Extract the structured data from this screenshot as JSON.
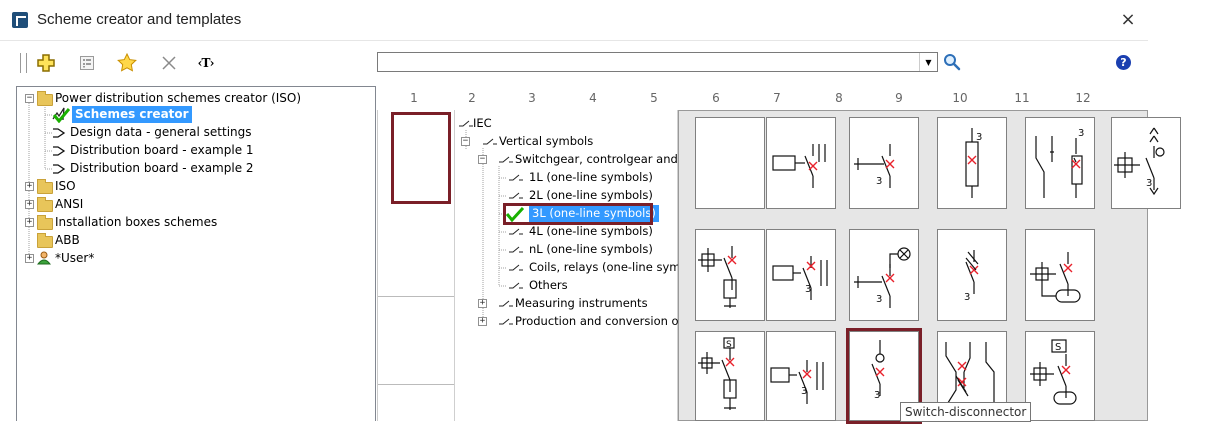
{
  "window": {
    "title": "Scheme creator and templates",
    "close_symbol": "×"
  },
  "toolbar": {
    "buttons": [
      {
        "name": "add-button",
        "icon": "plus-icon"
      },
      {
        "name": "properties-button",
        "icon": "properties-icon"
      },
      {
        "name": "favorite-button",
        "icon": "star-icon"
      },
      {
        "name": "delete-button",
        "icon": "close-x-icon"
      },
      {
        "name": "text-tag-button",
        "icon": "text-tag-icon",
        "label": "‹T›"
      }
    ],
    "search": {
      "value": "",
      "placeholder": ""
    },
    "dropdown_symbol": "▼",
    "help_symbol": "?"
  },
  "tree": {
    "items": [
      {
        "label": "Power distribution schemes creator (ISO)",
        "expander": "−",
        "icon": "folder-icon"
      },
      {
        "label": "Schemes creator",
        "icon": "check-icon",
        "selected": true
      },
      {
        "label": "Design data - general settings",
        "icon": "arrow-icon"
      },
      {
        "label": "Distribution board - example 1",
        "icon": "arrow-icon"
      },
      {
        "label": "Distribution board - example 2",
        "icon": "arrow-icon"
      },
      {
        "label": "ISO",
        "expander": "+",
        "icon": "folder-icon"
      },
      {
        "label": "ANSI",
        "expander": "+",
        "icon": "folder-icon"
      },
      {
        "label": "Installation boxes schemes",
        "expander": "+",
        "icon": "folder-icon"
      },
      {
        "label": "ABB",
        "icon": "folder-icon"
      },
      {
        "label": "*User*",
        "expander": "+",
        "icon": "user-icon"
      }
    ]
  },
  "column_numbers": [
    "1",
    "2",
    "3",
    "4",
    "5",
    "6",
    "7",
    "8",
    "9",
    "10",
    "11",
    "12"
  ],
  "symbol_tree": {
    "items": [
      {
        "label": "IEC"
      },
      {
        "label": "Vertical symbols",
        "expander": "−"
      },
      {
        "label": "Switchgear, controlgear and p",
        "expander": "−"
      },
      {
        "label": "1L (one-line symbols)"
      },
      {
        "label": "2L (one-line symbols)"
      },
      {
        "label": "3L (one-line symbols)",
        "selected": true
      },
      {
        "label": "4L (one-line symbols)"
      },
      {
        "label": "nL (one-line symbols)"
      },
      {
        "label": "Coils, relays (one-line sym"
      },
      {
        "label": "Others"
      },
      {
        "label": "Measuring instruments",
        "expander": "+"
      },
      {
        "label": "Production and conversion of",
        "expander": "+"
      }
    ]
  },
  "symbols": {
    "row1": [
      "empty",
      "contactor-relay",
      "circuit-breaker",
      "fuse",
      "fuse-switch",
      "motor-protection-breaker"
    ],
    "row2": [
      "motor-starter",
      "contactor-breaker",
      "breaker-lamp",
      "thermal-breaker",
      "breaker-coil"
    ],
    "row3": [
      "starter-combo",
      "relay-contactor",
      "switch-disconnector",
      "rcd-breaker",
      "smart-breaker"
    ],
    "selected": "switch-disconnector"
  },
  "tooltip": "Switch-disconnector",
  "colors": {
    "selection": "#3399ff",
    "highlight": "#7a1f28",
    "cross": "#e8212b"
  }
}
